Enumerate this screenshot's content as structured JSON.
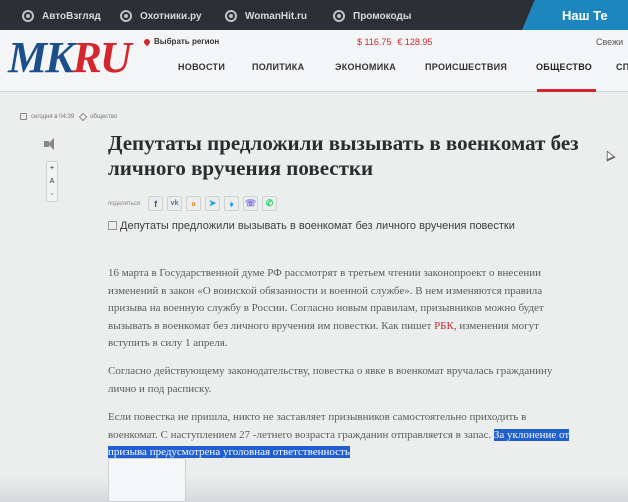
{
  "topbar": {
    "partners": [
      {
        "label": "АвтоВзгляд"
      },
      {
        "label": "Охотники.ру"
      },
      {
        "label": "WomanHit.ru"
      },
      {
        "label": "Промокоды"
      }
    ],
    "promo_label": "Наш Те"
  },
  "header": {
    "logo": {
      "part1": "MK",
      "part2": "RU"
    },
    "region_label": "Выбрать регион",
    "rates": {
      "usd": "$ 116.75",
      "eur": "€ 128.95"
    },
    "fresh_label": "Свежи",
    "nav": [
      {
        "label": "НОВОСТИ"
      },
      {
        "label": "ПОЛИТИКА"
      },
      {
        "label": "ЭКОНОМИКА"
      },
      {
        "label": "ПРОИСШЕСТВИЯ"
      },
      {
        "label": "ОБЩЕСТВО"
      },
      {
        "label": "СП"
      }
    ],
    "active_nav": "ОБЩЕСТВО"
  },
  "article": {
    "meta_date": "сегодня в 04:39",
    "meta_rubric": "общество",
    "title": "Депутаты предложили вызывать в военкомат без личного вручения повестки",
    "font_controls": [
      "+",
      "A",
      "-"
    ],
    "share_label": "поделиться",
    "share_buttons": [
      {
        "glyph": "f",
        "color": "#3b5998"
      },
      {
        "glyph": "vk",
        "color": "#4a76a8"
      },
      {
        "glyph": "ok",
        "color": "#ee8208"
      },
      {
        "glyph": "tg",
        "color": "#2ca5e0"
      },
      {
        "glyph": "tw",
        "color": "#1da1f2"
      },
      {
        "glyph": "vb",
        "color": "#7360f2"
      },
      {
        "glyph": "wa",
        "color": "#25d366"
      }
    ],
    "image_alt": "Депутаты предложили вызывать в военкомат без личного вручения повестки",
    "p1_before": "16 марта в Государственной думе РФ рассмотрят в третьем чтении законопроект о внесении изменений в закон «О воинской обязанности и военной службе». В нем изменяются правила призыва на военную службу в России. Согласно новым правилам, призывников можно будет вызывать в военкомат без личного вручения им повестки. Как пишет ",
    "p1_link": "РБК",
    "p1_after": ", изменения могут вступить в силу 1 апреля.",
    "p2": "Согласно действующему законодательству, повестка о явке в военкомат вручалась гражданину лично и под расписку.",
    "p3_plain": "Если повестка не пришла, никто не заставляет призывников самостоятельно приходить в военкомат. С наступлением 27 -летнего возраста  гражданин отправляется в запас. ",
    "p3_selected": "За уклонение от призыва предусмотрена уголовная ответственность"
  }
}
